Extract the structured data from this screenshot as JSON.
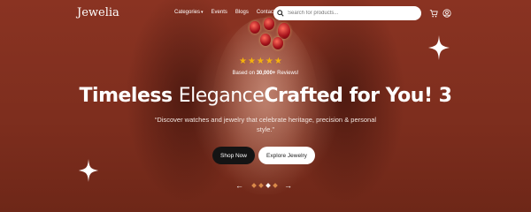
{
  "nav": {
    "logo": "Jewelia",
    "links": [
      "Categories",
      "Events",
      "Blogs",
      "Contact Us"
    ],
    "search_placeholder": "Search for products..."
  },
  "hero": {
    "stars": "★★★★★",
    "rating": 5,
    "reviews_prefix": "Based on ",
    "reviews_count": "30,000+",
    "reviews_suffix": " Reviews!",
    "headline_part1": "Timeless ",
    "headline_part2": "Elegance",
    "headline_part3": "Crafted for You! 3",
    "subtitle": "“Discover watches and jewelry that celebrate heritage, precision & personal style.”",
    "cta_primary": "Shop Now",
    "cta_secondary": "Explore Jewelry"
  },
  "slider": {
    "prev_label": "←",
    "next_label": "→",
    "total": 4,
    "active": 3
  },
  "colors": {
    "accent": "#f5b20c",
    "dot_inactive": "#d98a4a",
    "background": "#7a2c1c"
  }
}
